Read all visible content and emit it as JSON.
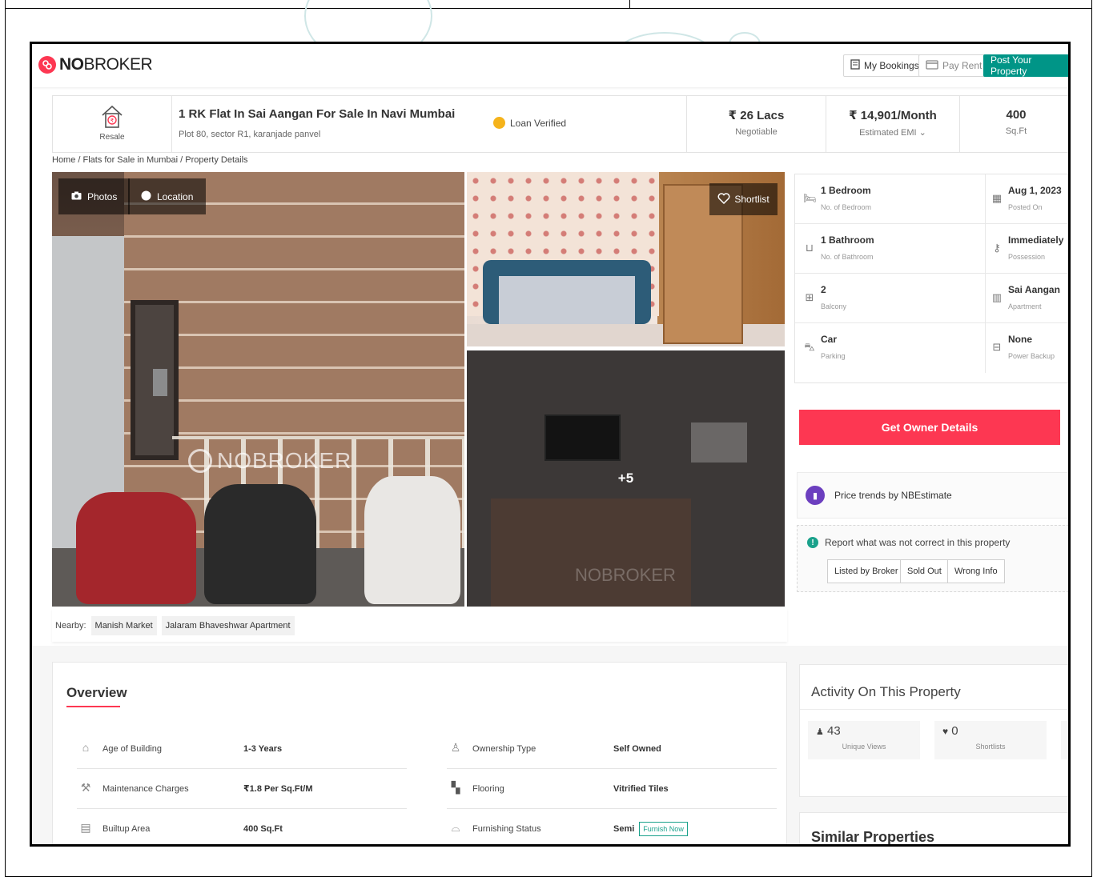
{
  "header": {
    "logo_bold": "NO",
    "logo_light": "BROKER",
    "my_bookings": "My Bookings",
    "pay_rent": "Pay Rent",
    "post_property": "Post Your Property"
  },
  "listing": {
    "type_label": "Resale",
    "title": "1 RK Flat In Sai Aangan For Sale In Navi Mumbai",
    "address": "Plot 80, sector R1, karanjade panvel",
    "loan_badge": "Loan Verified",
    "price": "₹ 26 Lacs",
    "price_note": "Negotiable",
    "emi": "₹ 14,901/Month",
    "emi_note": "Estimated EMI ⌄",
    "area": "400",
    "area_unit": "Sq.Ft"
  },
  "breadcrumb": "Home / Flats for Sale in Mumbai / Property Details",
  "gallery": {
    "photos_btn": "Photos",
    "location_btn": "Location",
    "shortlist_btn": "Shortlist",
    "more_count": "+5",
    "watermark": "NOBROKER"
  },
  "nearby": {
    "label": "Nearby:",
    "places": [
      "Manish Market",
      "Jalaram Bhaveshwar Apartment"
    ]
  },
  "specs": [
    {
      "value": "1 Bedroom",
      "label": "No. of Bedroom",
      "icon": "bed-icon"
    },
    {
      "value": "Aug 1, 2023",
      "label": "Posted On",
      "icon": "calendar-icon"
    },
    {
      "value": "1 Bathroom",
      "label": "No. of Bathroom",
      "icon": "bathtub-icon"
    },
    {
      "value": "Immediately",
      "label": "Possession",
      "icon": "key-icon"
    },
    {
      "value": "2",
      "label": "Balcony",
      "icon": "balcony-icon"
    },
    {
      "value": "Sai Aangan",
      "label": "Apartment",
      "icon": "building-icon"
    },
    {
      "value": "Car",
      "label": "Parking",
      "icon": "car-icon"
    },
    {
      "value": "None",
      "label": "Power Backup",
      "icon": "battery-icon"
    }
  ],
  "cta": {
    "owner_details": "Get Owner Details",
    "price_trends": "Price trends by NBEstimate",
    "report_text": "Report what was not correct in this property",
    "report_options": [
      "Listed by Broker",
      "Sold Out",
      "Wrong Info"
    ]
  },
  "overview": {
    "title": "Overview",
    "rows": [
      {
        "label": "Age of Building",
        "value": "1-3 Years",
        "icon": "building-age-icon"
      },
      {
        "label": "Ownership Type",
        "value": "Self Owned",
        "icon": "owner-icon"
      },
      {
        "label": "Maintenance Charges",
        "value": "₹1.8 Per Sq.Ft/M",
        "icon": "maintenance-icon"
      },
      {
        "label": "Flooring",
        "value": "Vitrified Tiles",
        "icon": "flooring-icon"
      },
      {
        "label": "Builtup Area",
        "value": "400 Sq.Ft",
        "icon": "area-icon"
      },
      {
        "label": "Furnishing Status",
        "value": "Semi",
        "icon": "sofa-icon"
      }
    ],
    "furnish_now": "Furnish Now"
  },
  "activity": {
    "title": "Activity On This Property",
    "views": "43",
    "views_label": "Unique Views",
    "shortlists": "0",
    "shortlists_label": "Shortlists"
  },
  "similar": {
    "title": "Similar Properties"
  },
  "colors": {
    "brand": "#fd3752",
    "teal": "#009587",
    "loan": "#f5b31b"
  }
}
